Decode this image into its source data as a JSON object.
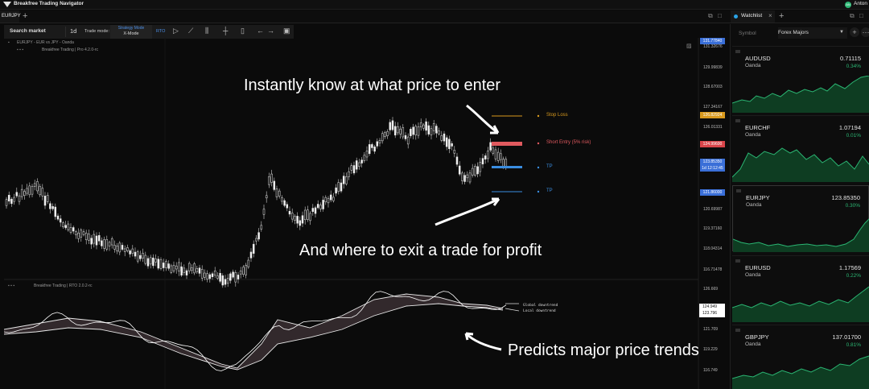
{
  "app": {
    "title": "Breakfree Trading Navigator",
    "user": "Anton",
    "user_initials": "AN"
  },
  "tabs": {
    "active": "EURJPY",
    "watchlist_tab": "Watchlist"
  },
  "toolbar": {
    "search": "Search market",
    "interval": "1d",
    "trade_mode_label": "Trade mode:",
    "strategy_mode": "Strategy Mode",
    "x_mode": "X-Mode",
    "rto": "RTO"
  },
  "chart": {
    "symbol_legend": "EURJPY - EUR vs JPY - Oanda",
    "indicator_legend": "Breakfree Trading | Pro 4.2.0-rc",
    "sub_indicator_legend": "Breakfree Trading | RTO 2.0.2-rc",
    "price_ticks": [
      "131.32676",
      "129.99839",
      "128.67003",
      "127.34167",
      "126.01331",
      "124.68495",
      "123.35659",
      "122.02823",
      "120.69987",
      "119.37160",
      "118.04314",
      "116.71478"
    ],
    "badges": [
      {
        "value": "131.77840",
        "color": "#3a6fd8"
      },
      {
        "value": "126.82924",
        "color": "#d99a1e"
      },
      {
        "value": "124.99600",
        "color": "#d9454a"
      },
      {
        "value": "123.85350",
        "color": "#3a6fd8"
      },
      {
        "value": "1d 12:12:45",
        "color": "#3a6fd8"
      },
      {
        "value": "121.86000",
        "color": "#3a6fd8"
      }
    ],
    "levels": [
      {
        "label": "Stop Loss",
        "color": "#d99a1e"
      },
      {
        "label": "Short Entry (5% risk)",
        "color": "#e05a5f"
      },
      {
        "label": "TP",
        "color": "#3a8de0"
      },
      {
        "label": "TP",
        "color": "#3a8de0"
      }
    ],
    "sub_ticks": [
      "126.669",
      "121.709",
      "119.229",
      "116.749"
    ],
    "sub_badge": [
      "124.949",
      "123.796"
    ],
    "trend_labels": {
      "global": "Global downtrend",
      "local": "Local downtrend"
    }
  },
  "callouts": {
    "enter": "Instantly know at what price to enter",
    "exit": "And where to exit a trade for profit",
    "trends": "Predicts major price trends"
  },
  "watchlist": {
    "symbol_label": "Symbol",
    "list_name": "Forex Majors",
    "items": [
      {
        "symbol": "AUDUSD",
        "source": "Oanda",
        "price": "0.71115",
        "change": "0.34%"
      },
      {
        "symbol": "EURCHF",
        "source": "Oanda",
        "price": "1.07194",
        "change": "0.01%"
      },
      {
        "symbol": "EURJPY",
        "source": "Oanda",
        "price": "123.85350",
        "change": "0.30%"
      },
      {
        "symbol": "EURUSD",
        "source": "Oanda",
        "price": "1.17569",
        "change": "0.22%"
      },
      {
        "symbol": "GBPJPY",
        "source": "Oanda",
        "price": "137.01700",
        "change": "0.81%"
      }
    ]
  }
}
